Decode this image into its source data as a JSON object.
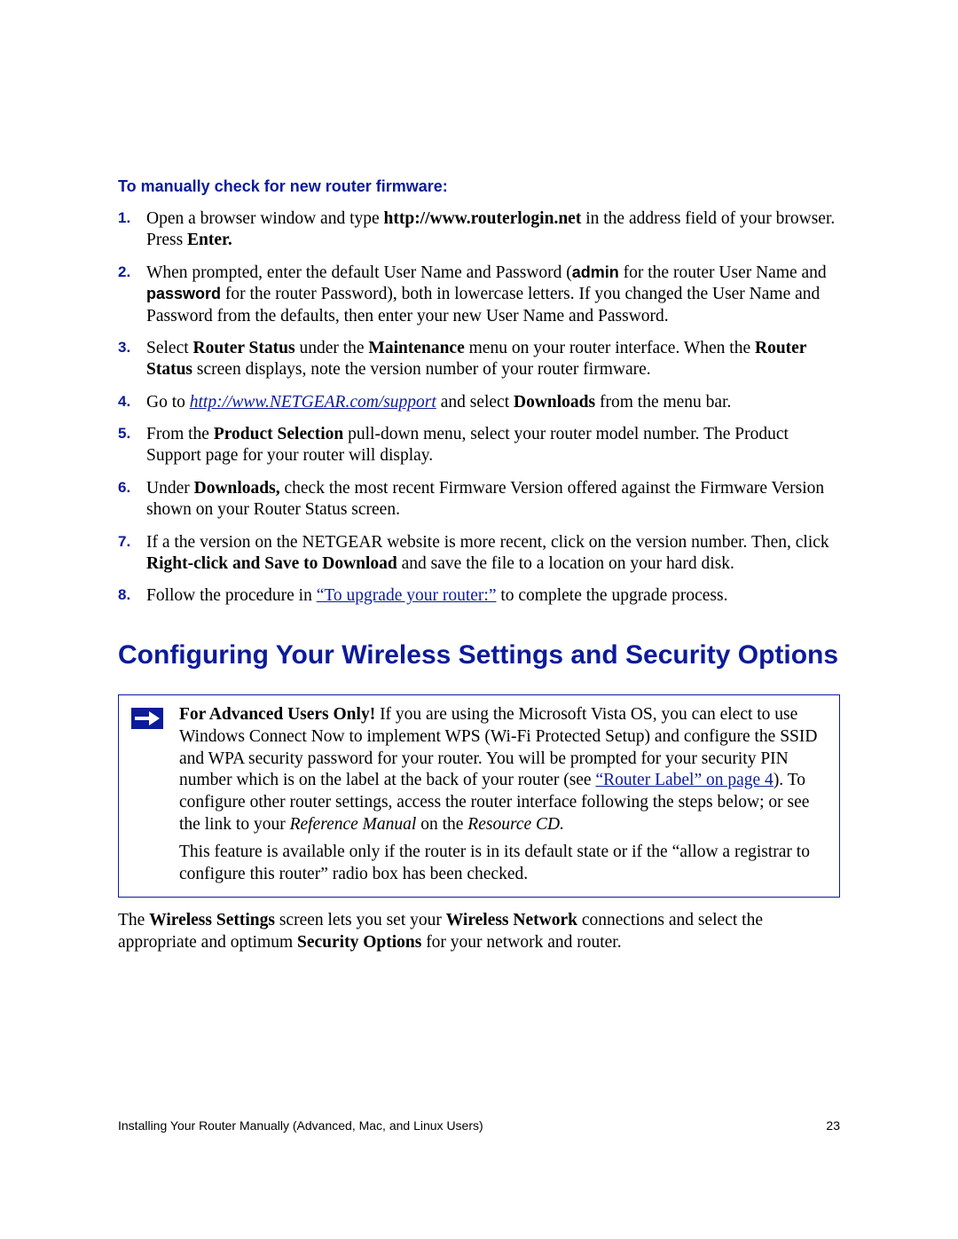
{
  "subheading": "To manually check for new router firmware:",
  "steps": {
    "s1": {
      "num": "1.",
      "t1": "Open a browser window and type ",
      "url": "http://www.routerlogin.net",
      "t2": " in the address field of your browser. Press ",
      "enter": "Enter."
    },
    "s2": {
      "num": "2.",
      "t1": "When prompted, enter the default User Name and Password (",
      "admin": "admin",
      "t2": " for the router User Name and ",
      "password": "password",
      "t3": " for the router Password), both in lowercase letters. If you changed the User Name and Password from the defaults, then enter your new User Name and Password."
    },
    "s3": {
      "num": "3.",
      "t1": "Select ",
      "rs1": "Router Status",
      "t2": " under the ",
      "maint": "Maintenance",
      "t3": " menu on your router interface. When the ",
      "rs2": "Router Status",
      "t4": " screen displays, note the version number of your router firmware."
    },
    "s4": {
      "num": "4.",
      "t1": "Go to ",
      "url": "http://www.NETGEAR.com/support",
      "t2": " and select ",
      "dl": "Downloads",
      "t3": " from the menu bar."
    },
    "s5": {
      "num": "5.",
      "t1": "From the ",
      "ps": "Product Selection",
      "t2": " pull-down menu, select your router model number. The Product Support page for your router will display."
    },
    "s6": {
      "num": "6.",
      "t1": "Under ",
      "dl": "Downloads,",
      "t2": " check the most recent Firmware Version offered against the Firmware Version shown on your Router Status screen."
    },
    "s7": {
      "num": "7.",
      "t1": "If a the version on the NETGEAR website is more recent, click on the version number. Then, click ",
      "rc": "Right-click and Save to Download",
      "t2": " and save the file to a location on your hard disk."
    },
    "s8": {
      "num": "8.",
      "t1": "Follow the procedure in ",
      "link": "“To upgrade your router:”",
      "t2": " to complete the upgrade process."
    }
  },
  "section_title": "Configuring Your Wireless Settings and Security Options",
  "note": {
    "p1": {
      "lead": "For Advanced Users Only!",
      "t1": " If you are using the Microsoft Vista OS, you can elect to use Windows Connect Now to implement WPS (Wi-Fi Protected Setup) and configure the SSID and WPA security password for your router. You will be prompted for your security PIN number which is on the label at the back of your router (see ",
      "link": "“Router Label” on page 4",
      "t2": "). To configure other router settings, access the router interface following the steps below; or see the link to your ",
      "refman": "Reference Manual",
      "t3": " on the ",
      "cd": "Resource CD."
    },
    "p2": "This feature is available only if the router is in its default state or if the “allow a registrar to configure this router” radio box has been checked."
  },
  "after_box": {
    "t1": "The ",
    "ws": "Wireless Settings",
    "t2": " screen lets you set your ",
    "wn": "Wireless Network",
    "t3": " connections and select the appropriate and optimum ",
    "so": "Security Options",
    "t4": " for your network and router."
  },
  "footer": {
    "left": "Installing Your Router Manually (Advanced, Mac, and Linux Users)",
    "right": "23"
  }
}
